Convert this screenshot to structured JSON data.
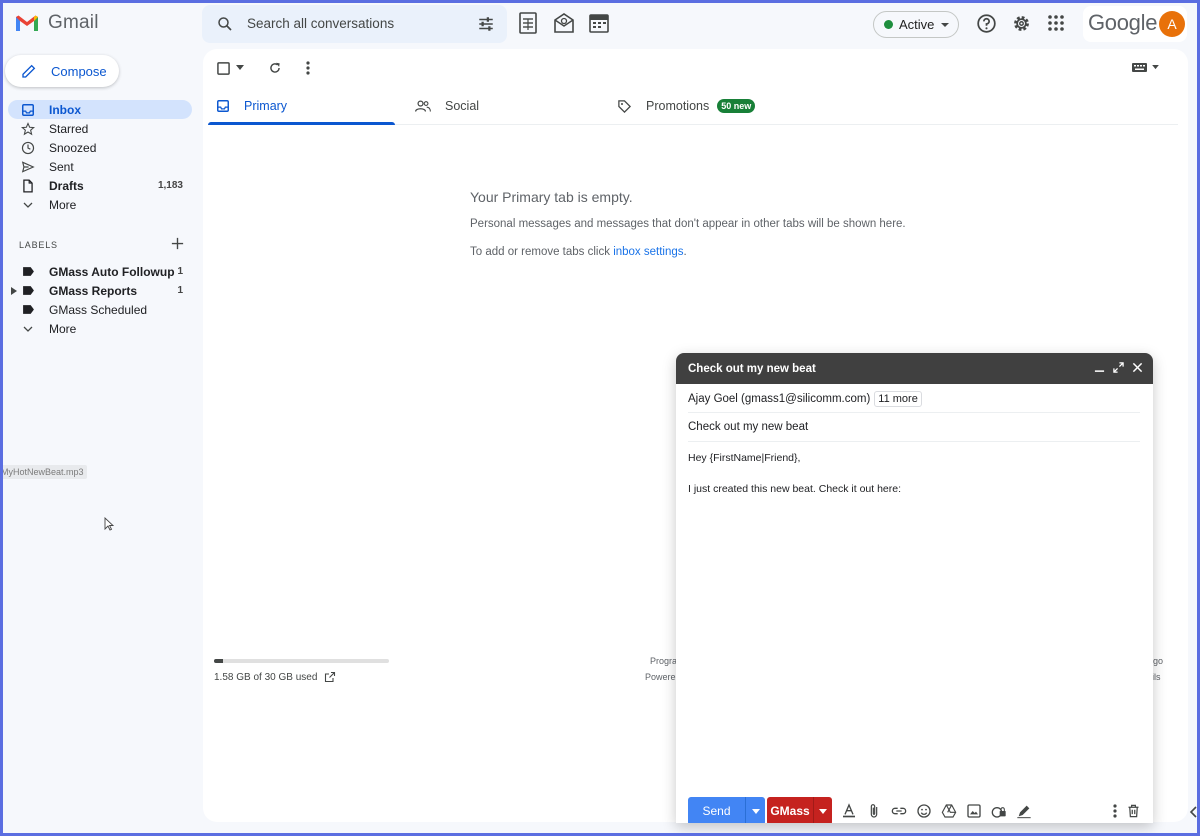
{
  "header": {
    "app_name": "Gmail",
    "search_placeholder": "Search all conversations",
    "status": "Active",
    "google_word": "Google",
    "avatar_letter": "A"
  },
  "sidebar": {
    "compose_label": "Compose",
    "items": [
      {
        "label": "Inbox",
        "icon": "inbox-icon",
        "count": ""
      },
      {
        "label": "Starred",
        "icon": "star-icon",
        "count": ""
      },
      {
        "label": "Snoozed",
        "icon": "clock-icon",
        "count": ""
      },
      {
        "label": "Sent",
        "icon": "send-icon",
        "count": ""
      },
      {
        "label": "Drafts",
        "icon": "draft-icon",
        "count": "1,183"
      },
      {
        "label": "More",
        "icon": "chevron-down-icon",
        "count": ""
      }
    ],
    "labels_heading": "LABELS",
    "labels": [
      {
        "label": "GMass Auto Followup",
        "count": "1"
      },
      {
        "label": "GMass Reports",
        "count": "1"
      },
      {
        "label": "GMass Scheduled",
        "count": ""
      },
      {
        "label": "More",
        "count": ""
      }
    ],
    "dragged_file": "MyHotNewBeat.mp3"
  },
  "main": {
    "tabs": [
      {
        "label": "Primary"
      },
      {
        "label": "Social"
      },
      {
        "label": "Promotions",
        "badge": "50 new"
      }
    ],
    "empty_title": "Your Primary tab is empty.",
    "empty_line1": "Personal messages and messages that don't appear in other tabs will be shown here.",
    "empty_line2_prefix": "To add or remove tabs click",
    "empty_line2_link": "inbox settings",
    "empty_line2_suffix": ".",
    "storage_text": "1.58 GB of 30 GB used",
    "storage_fraction": 0.053,
    "footer_frag_top": "Progra",
    "footer_frag_bottom": "Powere",
    "footer_frag_right_top": "go",
    "footer_frag_right_bottom": "ils"
  },
  "compose_window": {
    "title": "Check out my new beat",
    "to": "Ajay Goel (gmass1@silicomm.com)",
    "to_more": "11 more",
    "subject": "Check out my new beat",
    "body_line1": "Hey {FirstName|Friend},",
    "body_line2": "I just created this new beat. Check it out here:",
    "send_label": "Send",
    "gmass_label": "GMass"
  },
  "colors": {
    "accent": "#0b57d0",
    "selected_bg": "#d3e3fd",
    "send_blue": "#4285f4",
    "gmass_red": "#c5221f",
    "badge_green": "#188038",
    "compose_header": "#404040"
  }
}
